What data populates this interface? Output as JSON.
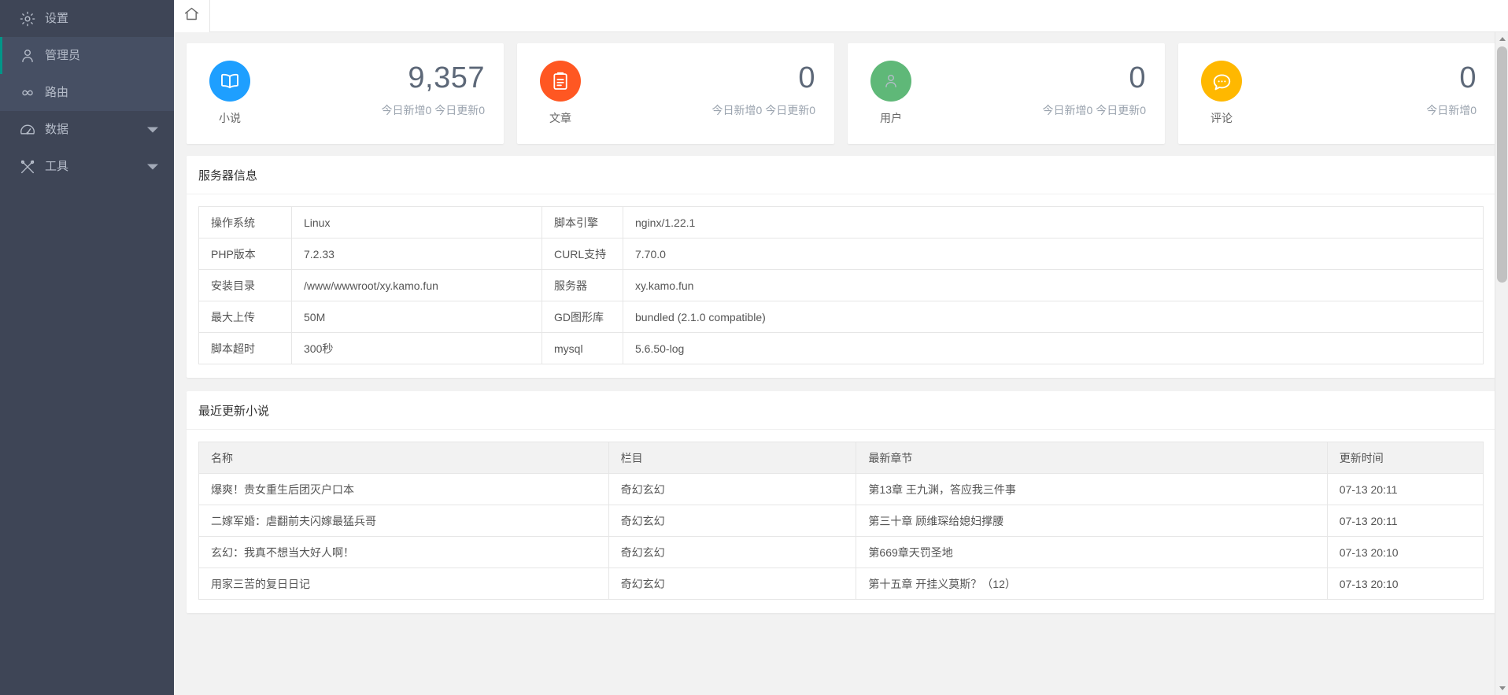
{
  "sidebar": {
    "items": [
      {
        "label": "设置",
        "icon": "gear-icon",
        "name": "settings",
        "state": "normal",
        "caret": false
      },
      {
        "label": "管理员",
        "icon": "user-icon",
        "name": "admin",
        "state": "active",
        "caret": false
      },
      {
        "label": "路由",
        "icon": "infinity-icon",
        "name": "route",
        "state": "hl",
        "caret": false
      },
      {
        "label": "数据",
        "icon": "gauge-icon",
        "name": "data",
        "state": "normal",
        "caret": true
      },
      {
        "label": "工具",
        "icon": "tools-icon",
        "name": "tools",
        "state": "normal",
        "caret": true
      }
    ]
  },
  "tabbar": {
    "tabs": [
      {
        "label": "",
        "icon": "home-icon",
        "name": "home",
        "active": true
      }
    ]
  },
  "cards": [
    {
      "category": "小说",
      "value": "9,357",
      "sub": "今日新增0 今日更新0",
      "color": "#1E9FFF",
      "icon": "book-icon"
    },
    {
      "category": "文章",
      "value": "0",
      "sub": "今日新增0 今日更新0",
      "color": "#FF5722",
      "icon": "clipboard-icon"
    },
    {
      "category": "用户",
      "value": "0",
      "sub": "今日新增0 今日更新0",
      "color": "#5FB878",
      "icon": "user-icon"
    },
    {
      "category": "评论",
      "value": "0",
      "sub": "今日新增0",
      "color": "#FFB800",
      "icon": "comment-icon"
    }
  ],
  "server_panel": {
    "title": "服务器信息",
    "rows": [
      {
        "k1": "操作系统",
        "v1": "Linux",
        "k2": "脚本引擎",
        "v2": "nginx/1.22.1"
      },
      {
        "k1": "PHP版本",
        "v1": "7.2.33",
        "k2": "CURL支持",
        "v2": "7.70.0"
      },
      {
        "k1": "安装目录",
        "v1": "/www/wwwroot/xy.kamo.fun",
        "k2": "服务器",
        "v2": "xy.kamo.fun"
      },
      {
        "k1": "最大上传",
        "v1": "50M",
        "k2": "GD图形库",
        "v2": "bundled (2.1.0 compatible)"
      },
      {
        "k1": "脚本超时",
        "v1": "300秒",
        "k2": "mysql",
        "v2": "5.6.50-log"
      }
    ]
  },
  "novel_panel": {
    "title": "最近更新小说",
    "headers": [
      "名称",
      "栏目",
      "最新章节",
      "更新时间"
    ],
    "rows": [
      {
        "name": "爆爽！贵女重生后团灭户口本",
        "column": "奇幻玄幻",
        "chapter": "第13章 王九渊，答应我三件事",
        "time": "07-13 20:11"
      },
      {
        "name": "二嫁军婚：虐翻前夫闪嫁最猛兵哥",
        "column": "奇幻玄幻",
        "chapter": "第三十章 顾维琛给媳妇撑腰",
        "time": "07-13 20:11"
      },
      {
        "name": "玄幻：我真不想当大好人啊！",
        "column": "奇幻玄幻",
        "chapter": "第669章天罚圣地",
        "time": "07-13 20:10"
      },
      {
        "name": "用家三苦的复日日记",
        "column": "奇幻玄幻",
        "chapter": "第十五章 开挂义莫斯？（12）",
        "time": "07-13 20:10"
      }
    ]
  },
  "scrollbar": {
    "name": "main-scrollbar"
  }
}
